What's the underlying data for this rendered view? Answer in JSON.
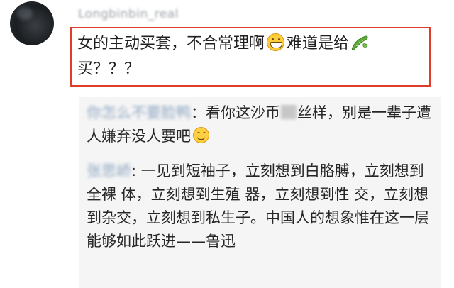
{
  "post": {
    "username": "Longbinbin_real",
    "comment_line1": "女的主动买套，不合常理啊",
    "comment_mid": "难道是给",
    "comment_line2": "买？？？",
    "emojis": [
      "grin-emoji",
      "cucumber-emoji"
    ]
  },
  "replies": [
    {
      "author": "你怎么不要脸鸭",
      "separator": "：",
      "text_before": "看你这沙币",
      "text_after": "丝样，别是一辈子遭人嫌弃没人要吧",
      "emoji": "smile-emoji"
    },
    {
      "author": "张思峤",
      "separator": ": ",
      "text": "一见到短袖子，立刻想到白胳膊，立刻想到全裸 体，立刻想到生殖 器，立刻想到性 交，立刻想到杂交，立刻想到私生子。中国人的想象惟在这一层能够如此跃进——鲁迅"
    }
  ],
  "colors": {
    "highlight_border": "#e03c2c",
    "reply_background": "#f5f5f5",
    "author_link": "#8fa7c2"
  }
}
